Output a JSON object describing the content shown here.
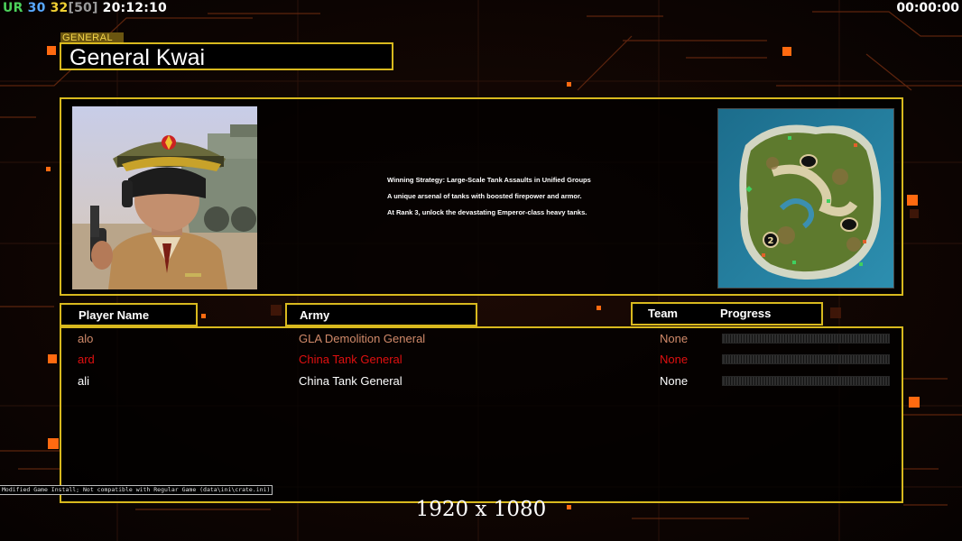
{
  "hud": {
    "ur": "UR",
    "val_a": "30",
    "val_b": "32",
    "val_c": "[50]",
    "clock": "20:12:10",
    "timer": "00:00:00"
  },
  "general": {
    "tag": "GENERAL",
    "name": "General Kwai"
  },
  "strategy": {
    "line1": "Winning Strategy: Large-Scale Tank Assaults in Unified Groups",
    "line2": "A unique arsenal of tanks with boosted firepower and armor.",
    "line3": "At Rank 3, unlock the devastating Emperor-class heavy tanks."
  },
  "map": {
    "player_marker": "2"
  },
  "table": {
    "headers": {
      "player": "Player Name",
      "army": "Army",
      "team": "Team",
      "progress": "Progress"
    },
    "rows": [
      {
        "name": "alo",
        "army": "GLA Demolition General",
        "team": "None",
        "color": "#d18a6a",
        "progress": 0
      },
      {
        "name": "ard",
        "army": "China Tank General",
        "team": "None",
        "color": "#e01010",
        "progress": 0
      },
      {
        "name": "ali",
        "army": "China Tank General",
        "team": "None",
        "color": "#ffffff",
        "progress": 0
      }
    ]
  },
  "footer": {
    "mod_note": "Modified Game Install; Not compatible with Regular Game (data\\ini\\crate.ini)",
    "resolution": "1920 x 1080"
  },
  "colors": {
    "accent": "#d8b91e",
    "background": "#0b0403",
    "orange_highlight": "#ff7a10"
  }
}
